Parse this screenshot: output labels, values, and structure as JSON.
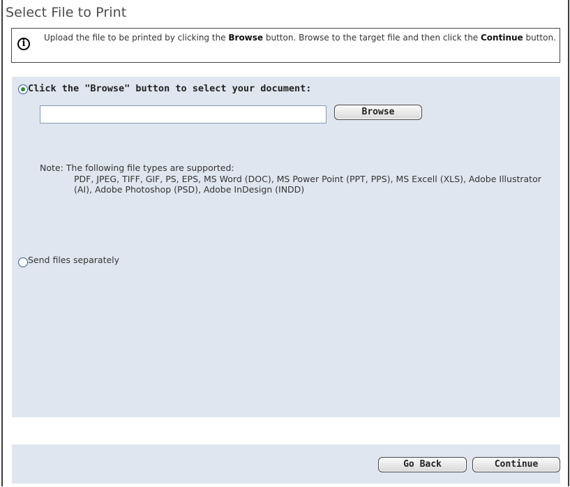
{
  "page": {
    "title": "Select File to Print"
  },
  "info": {
    "icon": "info-icon",
    "glyph": "i",
    "text_before": "Upload the file to be printed by clicking the ",
    "bold1": "Browse",
    "text_middle": " button. Browse to the target file and then click the ",
    "bold2": "Continue",
    "text_after": " button."
  },
  "upload_option": {
    "label": "Click the \"Browse\" button to select your document:",
    "selected": true,
    "file_value": "",
    "browse_label": "Browse"
  },
  "note": {
    "prefix": "Note: The following file types are supported:",
    "types": "PDF, JPEG, TIFF, GIF, PS, EPS, MS Word (DOC), MS Power Point (PPT, PPS), MS Excell (XLS), Adobe Illustrator (AI), Adobe Photoshop (PSD), Adobe InDesign (INDD)"
  },
  "separate_option": {
    "label": "Send files separately",
    "selected": false
  },
  "footer": {
    "go_back_label": "Go Back",
    "continue_label": "Continue"
  },
  "colors": {
    "panel_bg": "#e0e6ef",
    "radio_dot": "#2f8f3a",
    "radio_border": "#2b5f9a"
  }
}
